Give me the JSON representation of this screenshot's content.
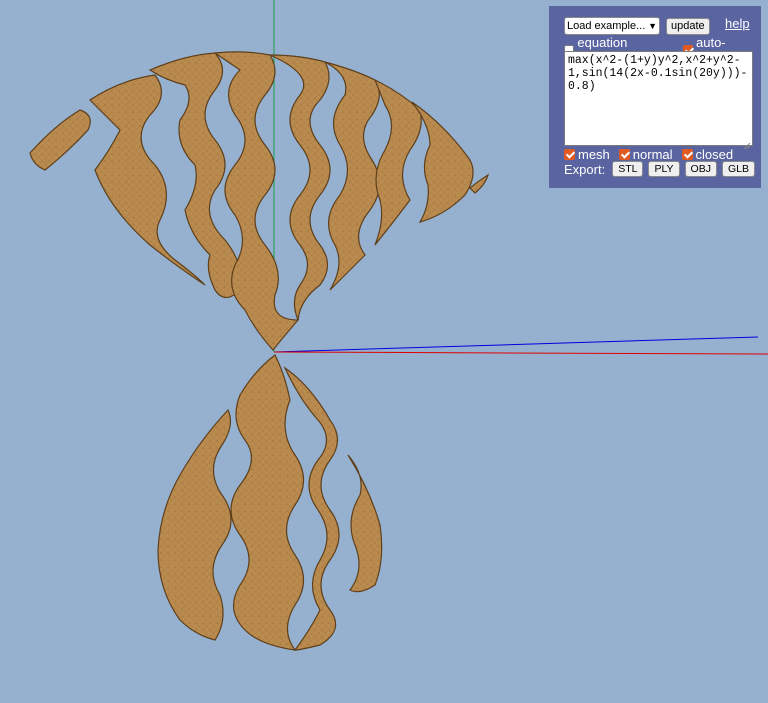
{
  "scene": {
    "background_color": "#95b1cf",
    "surface_color": "#b8894e",
    "axis_colors": {
      "x": "#e00000",
      "y": "#1a9a4a",
      "z": "#0000e0"
    }
  },
  "panel": {
    "example_select": {
      "value": "Load example...",
      "icon": "chevron-down-icon"
    },
    "update_label": "update",
    "help_label": "help",
    "equation_preview": {
      "label": "equation preview",
      "checked": false
    },
    "auto_update": {
      "label": "auto-update",
      "checked": true
    },
    "formula": "max(x^2-(1+y)y^2,x^2+y^2-1,sin(14(2x-0.1sin(20y)))-0.8)",
    "mesh": {
      "label": "mesh",
      "checked": true
    },
    "normal": {
      "label": "normal",
      "checked": true
    },
    "closed": {
      "label": "closed",
      "checked": true
    },
    "export_label": "Export:",
    "export_buttons": [
      "STL",
      "PLY",
      "OBJ",
      "GLB"
    ]
  }
}
